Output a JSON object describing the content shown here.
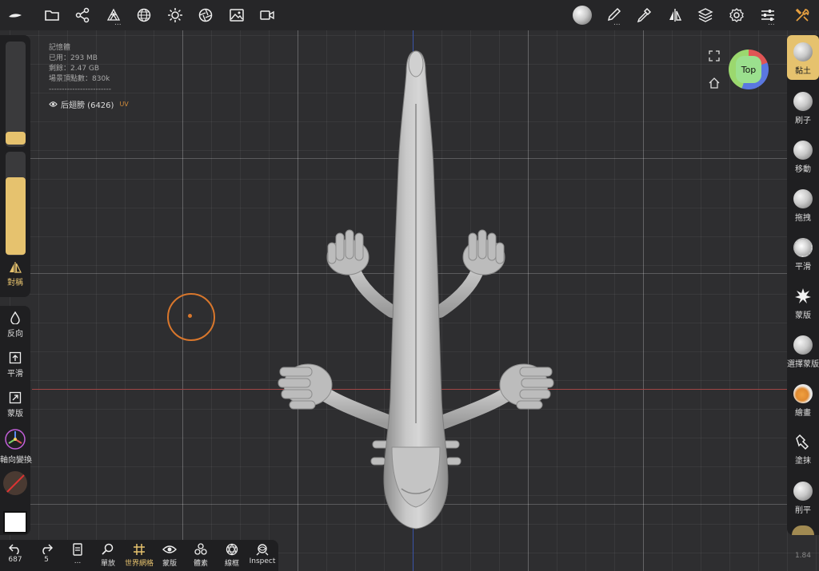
{
  "top_toolbar": {
    "icons": [
      "logo-icon",
      "folder-icon",
      "scene-graph-icon",
      "topology-icon",
      "sphere-grid-icon",
      "light-icon",
      "aperture-icon",
      "image-icon",
      "video-icon",
      "matcap-ball-icon",
      "brush-icon",
      "picker-icon",
      "symmetry-icon",
      "layers-icon",
      "settings-icon",
      "sliders-icon",
      "tools-icon"
    ],
    "dots": "..."
  },
  "stats": {
    "title": "記憶體",
    "used": "已用：293 MB",
    "free": "剩餘：2.47 GB",
    "vertices": "場景頂點數：830k",
    "divider": "------------------------"
  },
  "mesh": {
    "name": "后翅膀 (6426)",
    "uv": "UV"
  },
  "nav": {
    "face_label": "Top"
  },
  "left_panel": {
    "symmetry": "對稱",
    "invert": "反向",
    "smooth": "平滑",
    "mask": "蒙版",
    "gizmo": "軸向變換"
  },
  "right_tools": [
    {
      "label": "黏土"
    },
    {
      "label": "刷子"
    },
    {
      "label": "移動"
    },
    {
      "label": "拖拽"
    },
    {
      "label": "平滑"
    },
    {
      "label": "蒙版"
    },
    {
      "label": "選擇蒙版"
    },
    {
      "label": "繪畫"
    },
    {
      "label": "塗抹"
    },
    {
      "label": "削平"
    }
  ],
  "bottom_bar": {
    "undo_count": "687",
    "redo_count": "5",
    "more": "...",
    "zoom": "單放",
    "world_grid": "世界網格",
    "mask": "蒙版",
    "voxel": "體素",
    "wireframe": "線框",
    "inspect": "Inspect"
  },
  "version": "1.84",
  "colors": {
    "accent": "#e6c26e",
    "brush_cursor": "#d9772c",
    "axis_x": "#a04646",
    "axis_z": "#3a54a8"
  }
}
